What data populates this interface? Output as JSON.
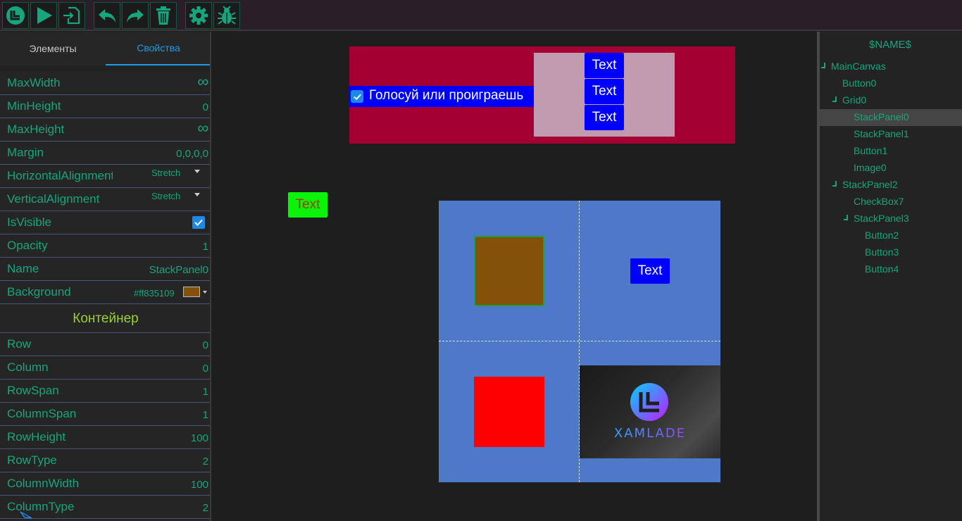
{
  "left_panel": {
    "tabs": [
      "Элементы",
      "Свойства"
    ],
    "properties_top": [
      {
        "label": "MaxWidth",
        "value": "∞"
      },
      {
        "label": "MinHeight",
        "value": "0"
      },
      {
        "label": "MaxHeight",
        "value": "∞"
      },
      {
        "label": "Margin",
        "value": "0,0,0,0"
      },
      {
        "label": "HorizontalAlignment",
        "value": "Stretch"
      },
      {
        "label": "VerticalAlignment",
        "value": "Stretch"
      },
      {
        "label": "IsVisible",
        "value": ""
      },
      {
        "label": "Opacity",
        "value": "1"
      },
      {
        "label": "Name",
        "value": "StackPanel0"
      },
      {
        "label": "Background",
        "value": "#ff835109"
      }
    ],
    "section_container": "Контейнер",
    "properties_container": [
      {
        "label": "Row",
        "value": "0"
      },
      {
        "label": "Column",
        "value": "0"
      },
      {
        "label": "RowSpan",
        "value": "1"
      },
      {
        "label": "ColumnSpan",
        "value": "1"
      },
      {
        "label": "RowHeight",
        "value": "100"
      },
      {
        "label": "RowType",
        "value": "2"
      },
      {
        "label": "ColumnWidth",
        "value": "100"
      },
      {
        "label": "ColumnType",
        "value": "2"
      }
    ]
  },
  "canvas": {
    "checkbox_label": "Голосуй или проиграешь",
    "stack_buttons": [
      "Text",
      "Text",
      "Text"
    ],
    "green_button": "Text",
    "grid_button": "Text",
    "logo_text": "XAMLADE"
  },
  "tree": {
    "title": "$NAME$",
    "nodes": [
      {
        "label": "MainCanvas",
        "level": 0,
        "expandable": true
      },
      {
        "label": "Button0",
        "level": 1,
        "expandable": false
      },
      {
        "label": "Grid0",
        "level": 1,
        "expandable": true
      },
      {
        "label": "StackPanel0",
        "level": 2,
        "expandable": false,
        "selected": true
      },
      {
        "label": "StackPanel1",
        "level": 2,
        "expandable": false
      },
      {
        "label": "Button1",
        "level": 2,
        "expandable": false
      },
      {
        "label": "Image0",
        "level": 2,
        "expandable": false
      },
      {
        "label": "StackPanel2",
        "level": 1,
        "expandable": true
      },
      {
        "label": "CheckBox7",
        "level": 2,
        "expandable": false
      },
      {
        "label": "StackPanel3",
        "level": 2,
        "expandable": true
      },
      {
        "label": "Button2",
        "level": 3,
        "expandable": false
      },
      {
        "label": "Button3",
        "level": 3,
        "expandable": false
      },
      {
        "label": "Button4",
        "level": 3,
        "expandable": false
      }
    ]
  },
  "colors": {
    "accent_green": "#17a57c",
    "tab_active": "#1e9be6",
    "section_color": "#9bcf36",
    "selected_background": "#835109"
  }
}
